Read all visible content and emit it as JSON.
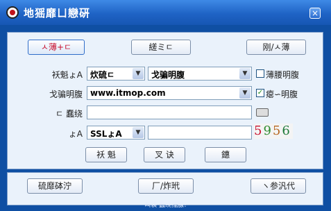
{
  "window": {
    "title": "地猺靡ㄩ戀硏",
    "close_label": "×"
  },
  "mode_buttons": [
    {
      "label": "ㅅ薄+ㄷ"
    },
    {
      "label": "縒ミㄷ"
    },
    {
      "label": "刚/ㅅ薄"
    }
  ],
  "form": {
    "row1": {
      "label": "袄魁ょA",
      "select1_value": "炊硫ㄷ",
      "select2_value": "戈骗明腹",
      "checkbox_label": "薄腰明腹",
      "checkbox_checked": false
    },
    "row2": {
      "label": "戈骗明腹",
      "value": "www.itmop.com",
      "checkbox_label": "瘪∽明腹",
      "checkbox_checked": true
    },
    "row3": {
      "label": "ㄷ  蠢绕",
      "value": ""
    },
    "row4": {
      "label": "ょA",
      "select_value": "SSLょA",
      "value": "",
      "captcha": [
        "5",
        "9",
        "5",
        "6"
      ]
    }
  },
  "actions": [
    {
      "label": "袄 魁"
    },
    {
      "label": "叉 诀"
    },
    {
      "label": "鏸"
    }
  ],
  "footer_buttons": [
    {
      "label": "硫靡砵泞"
    },
    {
      "label": "厂/炸玳"
    },
    {
      "label": "ヽ参汎代"
    }
  ],
  "status_text": "叫袋   蠢绕孺腺!"
}
